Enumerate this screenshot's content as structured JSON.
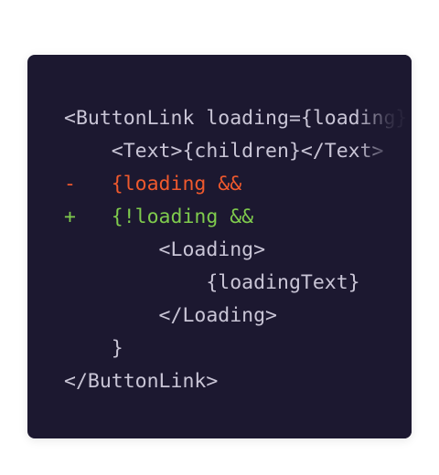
{
  "code": {
    "lines": [
      {
        "marker": "",
        "text": "<ButtonLink loading={loading}",
        "kind": "context"
      },
      {
        "marker": "",
        "text": "    <Text>{children}</Text>",
        "kind": "context"
      },
      {
        "marker": "-",
        "text": "   {loading &&",
        "kind": "deleted"
      },
      {
        "marker": "+",
        "text": "   {!loading &&",
        "kind": "added"
      },
      {
        "marker": "",
        "text": "        <Loading>",
        "kind": "context"
      },
      {
        "marker": "",
        "text": "            {loadingText}",
        "kind": "context"
      },
      {
        "marker": "",
        "text": "        </Loading>",
        "kind": "context"
      },
      {
        "marker": "",
        "text": "    }",
        "kind": "context"
      },
      {
        "marker": "",
        "text": "</ButtonLink>",
        "kind": "context"
      }
    ]
  },
  "colors": {
    "background": "#1c1830",
    "text": "#c9c5d6",
    "deleted": "#f0592d",
    "added": "#7fcb4d"
  }
}
